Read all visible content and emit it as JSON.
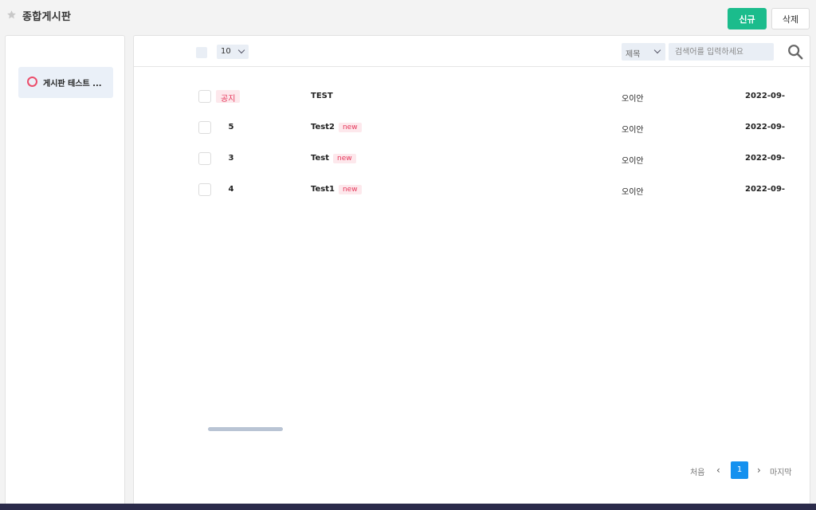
{
  "header": {
    "title": "종합게시판",
    "new_button": "신규",
    "delete_button": "삭제"
  },
  "sidebar": {
    "items": [
      {
        "label": "게시판 테스트 ..."
      }
    ]
  },
  "toolbar": {
    "page_size": "10",
    "search_field": "제목",
    "search_placeholder": "검색어를 입력하세요"
  },
  "posts": [
    {
      "number": "",
      "notice_label": "공지",
      "title": "TEST",
      "badge": "",
      "author": "오이안",
      "date": "2022-09-"
    },
    {
      "number": "5",
      "title": "Test2",
      "badge": "new",
      "author": "오이안",
      "date": "2022-09-"
    },
    {
      "number": "3",
      "title": "Test",
      "badge": "new",
      "author": "오이안",
      "date": "2022-09-"
    },
    {
      "number": "4",
      "title": "Test1",
      "badge": "new",
      "author": "오이안",
      "date": "2022-09-"
    }
  ],
  "pagination": {
    "first": "처음",
    "prev": "‹",
    "current": "1",
    "next": "›",
    "last": "마지막"
  },
  "colors": {
    "accent_green": "#1bbc8c",
    "accent_pink": "#e5385b",
    "page_blue": "#1591ef"
  },
  "icons": {
    "favorite": "star-icon",
    "board": "ring-icon",
    "search": "search-icon",
    "dropdown": "chevron-down-icon"
  }
}
